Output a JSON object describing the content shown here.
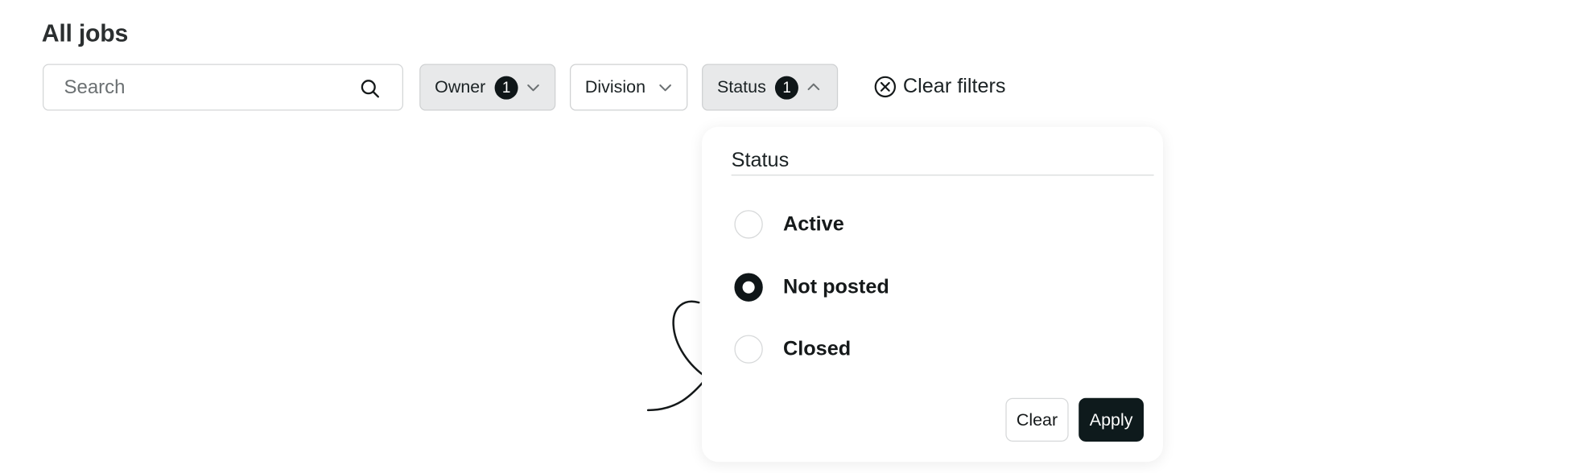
{
  "page": {
    "title": "All jobs"
  },
  "search": {
    "placeholder": "Search",
    "value": "",
    "icon": "search-icon"
  },
  "filters": {
    "owner": {
      "label": "Owner",
      "count": "1",
      "icon": "chevron-down-icon"
    },
    "division": {
      "label": "Division",
      "icon": "chevron-down-icon"
    },
    "status": {
      "label": "Status",
      "count": "1",
      "icon": "chevron-up-icon"
    },
    "clear_label": "Clear filters",
    "clear_icon": "close-circle-icon"
  },
  "status_panel": {
    "title": "Status",
    "options": [
      {
        "label": "Active",
        "checked": false
      },
      {
        "label": "Not posted",
        "checked": true
      },
      {
        "label": "Closed",
        "checked": false
      }
    ],
    "clear_label": "Clear",
    "apply_label": "Apply"
  },
  "colors": {
    "accent": "#0f1618",
    "active_filter_bg": "#e8e9ea"
  }
}
